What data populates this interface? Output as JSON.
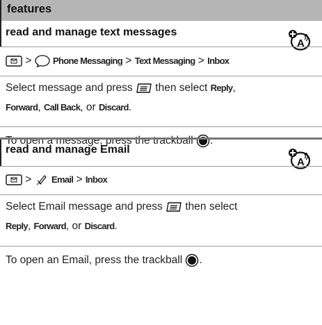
{
  "header": {
    "title": "features"
  },
  "sections": [
    {
      "title": "read and manage text messages",
      "path": {
        "sep": ">",
        "step1": "Phone Messaging",
        "step2": "Text Messaging",
        "step3": "Inbox"
      },
      "para1": {
        "a": "Select message and press",
        "b": "then select",
        "reply": "Reply",
        "comma1": ",",
        "forward": "Forward",
        "comma2": ",",
        "callback": "Call Back",
        "or": ", or",
        "discard": "Discard",
        "end": "."
      },
      "para2": {
        "a": "To open a message, press the trackball",
        "end": "."
      }
    },
    {
      "title": "read and manage Email",
      "path": {
        "sep": ">",
        "step1": "Email",
        "step2": "Inbox"
      },
      "para1": {
        "a": "Select Email message and press",
        "b": "then select",
        "reply": "Reply",
        "comma1": ",",
        "forward": "Forward",
        "or": ", or",
        "discard": "Discard",
        "end": "."
      },
      "para2": {
        "a": "To open an Email, press the trackball",
        "end": "."
      }
    }
  ]
}
